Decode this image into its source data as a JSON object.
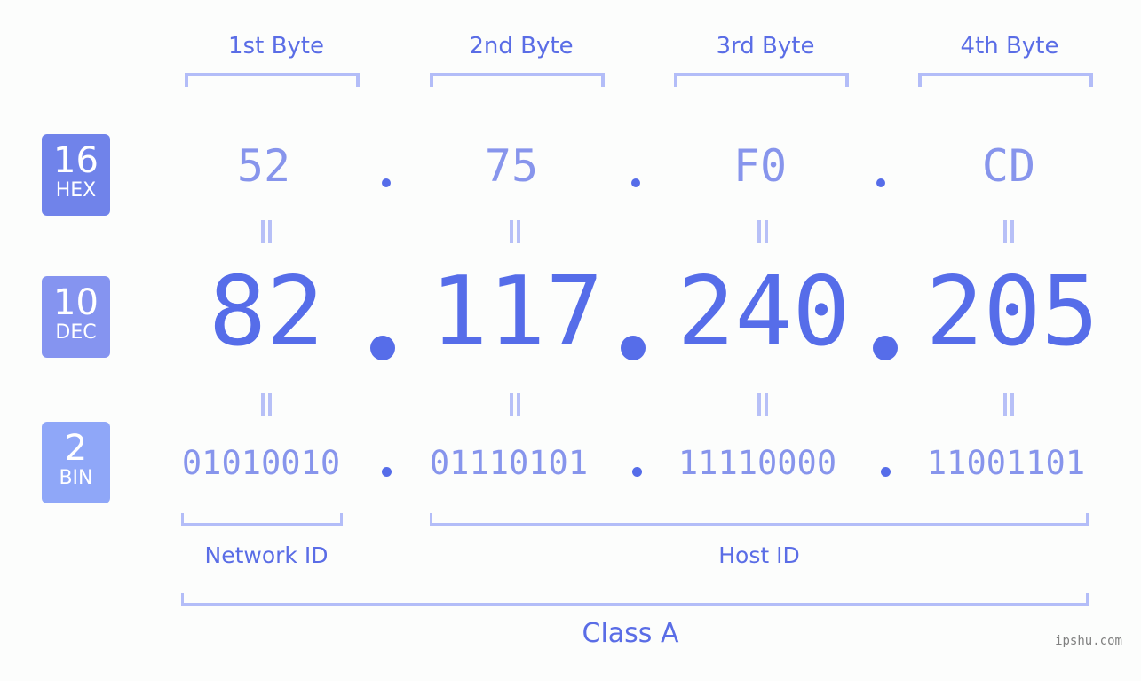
{
  "colors": {
    "accent": "#566de9",
    "light_value": "#8795ec",
    "bracket": "#b3bdf8",
    "badge_hex": "#7083ea",
    "badge_dec": "#8594f0",
    "badge_bin": "#8fa7f8",
    "background": "#fcfdfc"
  },
  "byte_headers": [
    "1st Byte",
    "2nd Byte",
    "3rd Byte",
    "4th Byte"
  ],
  "badges": {
    "hex": {
      "number": "16",
      "label": "HEX"
    },
    "dec": {
      "number": "10",
      "label": "DEC"
    },
    "bin": {
      "number": "2",
      "label": "BIN"
    }
  },
  "hex_values": [
    "52",
    "75",
    "F0",
    "CD"
  ],
  "dec_values": [
    "82",
    "117",
    "240",
    "205"
  ],
  "bin_values": [
    "01010010",
    "01110101",
    "11110000",
    "11001101"
  ],
  "separator": ".",
  "ip_address": "82.117.240.205",
  "network_id_label": "Network ID",
  "host_id_label": "Host ID",
  "class_label": "Class A",
  "watermark": "ipshu.com"
}
